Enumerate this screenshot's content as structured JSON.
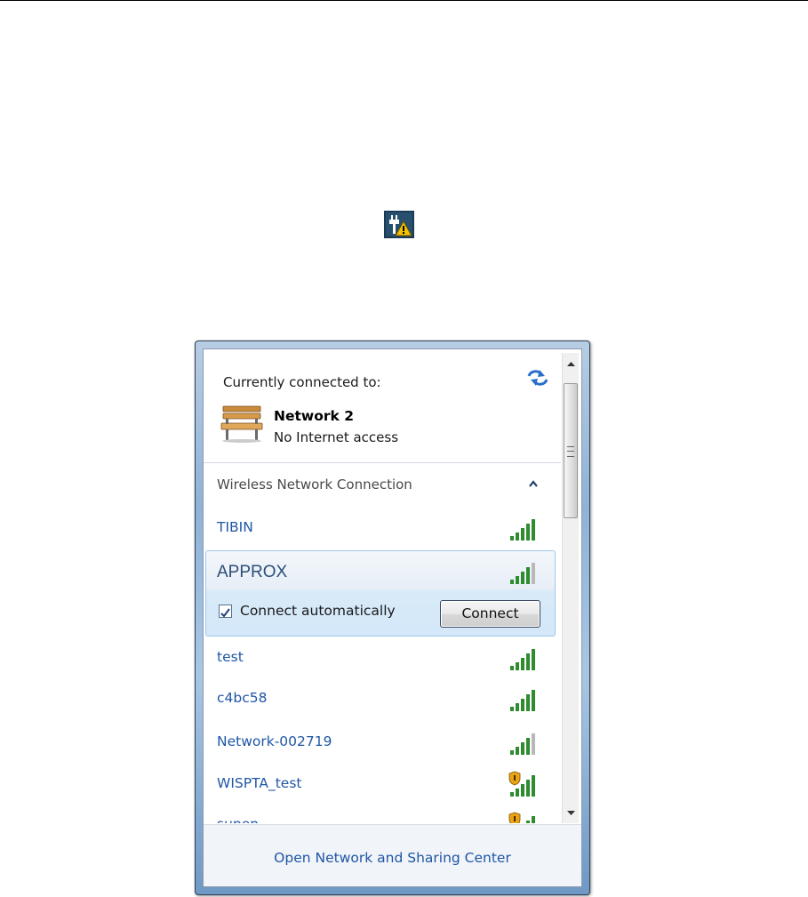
{
  "flyout": {
    "connected_title": "Currently connected to:",
    "connected_network": {
      "name": "Network  2",
      "status": "No Internet access"
    },
    "section_title": "Wireless Network Connection",
    "networks": [
      {
        "name": "TIBIN",
        "signal_bars": 5,
        "secured": false
      },
      {
        "name": "APPROX",
        "signal_bars": 4,
        "secured": false,
        "selected": true
      },
      {
        "name": "test",
        "signal_bars": 5,
        "secured": false
      },
      {
        "name": "c4bc58",
        "signal_bars": 5,
        "secured": false
      },
      {
        "name": "Network-002719",
        "signal_bars": 4,
        "secured": false
      },
      {
        "name": "WISPTA_test",
        "signal_bars": 5,
        "secured": true
      },
      {
        "name": "supen",
        "signal_bars": 5,
        "secured": true
      }
    ],
    "selected_network": {
      "name": "APPROX",
      "connect_automatically_label": "Connect automatically",
      "connect_automatically_checked": true,
      "connect_button_label": "Connect"
    },
    "footer_link": "Open Network and Sharing Center"
  },
  "icons": {
    "tray": "network-warning-icon",
    "refresh": "refresh-icon",
    "connected": "bench-icon",
    "collapse": "chevron-up-icon"
  },
  "colors": {
    "link": "#1f56a6",
    "signal_green": "#2e8b2e",
    "signal_gray": "#b8b8b8",
    "shield": "#e8a317"
  }
}
